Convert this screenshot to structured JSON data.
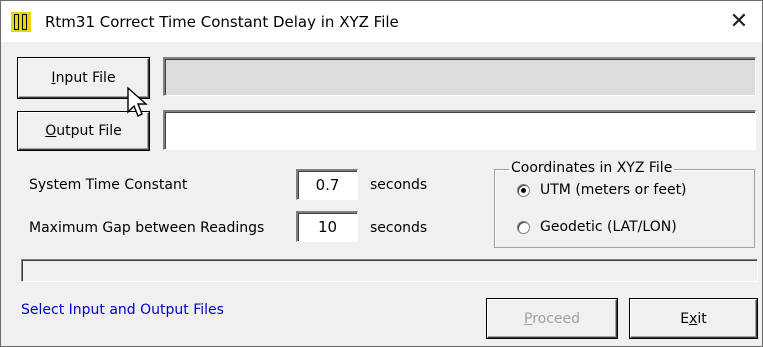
{
  "window": {
    "app_icon": "app-bars-icon",
    "title": "Rtm31   Correct Time Constant Delay in XYZ File",
    "close_label": "✕"
  },
  "files": {
    "input_button_prefix": "",
    "input_button_mnemonic": "I",
    "input_button_rest": "nput File",
    "input_path": "",
    "output_button_mnemonic": "O",
    "output_button_rest": "utput File",
    "output_path": ""
  },
  "params": {
    "time_constant_label": "System Time Constant",
    "time_constant_value": "0.7",
    "time_constant_unit": "seconds",
    "max_gap_label": "Maximum Gap between Readings",
    "max_gap_value": "10",
    "max_gap_unit": "seconds"
  },
  "coordinates": {
    "group_label": "Coordinates in XYZ File",
    "options": [
      {
        "label": "UTM (meters or feet)",
        "selected": true
      },
      {
        "label": "Geodetic (LAT/LON)",
        "selected": false
      }
    ]
  },
  "progress": {
    "value": 0
  },
  "status": {
    "message": "Select Input and Output Files"
  },
  "actions": {
    "proceed_mnemonic": "P",
    "proceed_rest": "roceed",
    "proceed_enabled": false,
    "exit_prefix": "E",
    "exit_mnemonic": "x",
    "exit_rest": "it"
  },
  "colors": {
    "status_text": "#0000cc",
    "app_icon": "#e8d800",
    "window_bg": "#f0f0f0"
  }
}
